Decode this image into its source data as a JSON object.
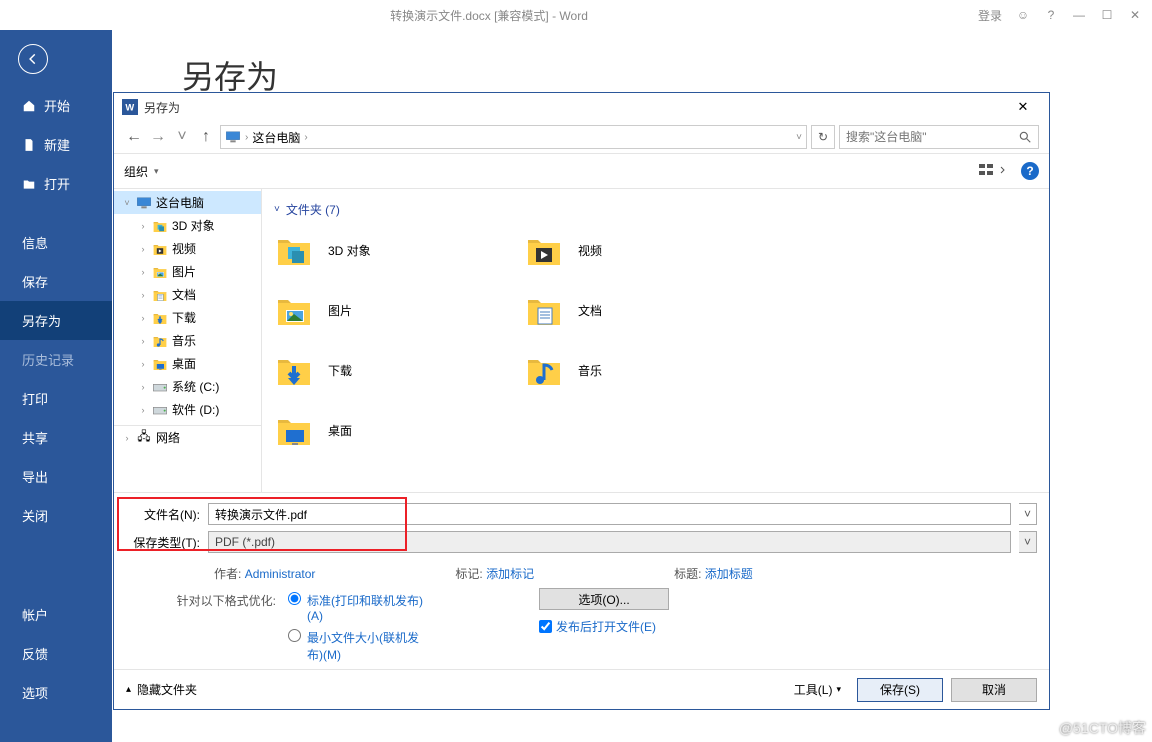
{
  "window": {
    "title": "转换演示文件.docx [兼容模式] - Word",
    "login": "登录"
  },
  "backstage": {
    "page_title": "另存为",
    "items": [
      {
        "label": "开始",
        "icon": "home"
      },
      {
        "label": "新建",
        "icon": "doc"
      },
      {
        "label": "打开",
        "icon": "open"
      },
      {
        "label": "信息"
      },
      {
        "label": "保存"
      },
      {
        "label": "另存为",
        "active": true
      },
      {
        "label": "历史记录",
        "dim": true
      },
      {
        "label": "打印"
      },
      {
        "label": "共享"
      },
      {
        "label": "导出"
      },
      {
        "label": "关闭"
      }
    ],
    "bottom": [
      {
        "label": "帐户"
      },
      {
        "label": "反馈"
      },
      {
        "label": "选项"
      }
    ]
  },
  "dialog": {
    "title": "另存为",
    "breadcrumb": "这台电脑",
    "breadcrumb_sep": "›",
    "search_placeholder": "搜索\"这台电脑\"",
    "toolbar": {
      "organize": "组织",
      "down": "▾"
    },
    "tree": {
      "root": "这台电脑",
      "items": [
        {
          "label": "3D 对象",
          "icon": "3d"
        },
        {
          "label": "视频",
          "icon": "video"
        },
        {
          "label": "图片",
          "icon": "pic"
        },
        {
          "label": "文档",
          "icon": "doc"
        },
        {
          "label": "下载",
          "icon": "download"
        },
        {
          "label": "音乐",
          "icon": "music"
        },
        {
          "label": "桌面",
          "icon": "desktop"
        },
        {
          "label": "系统 (C:)",
          "icon": "drive"
        },
        {
          "label": "软件 (D:)",
          "icon": "drive"
        }
      ],
      "network": "网络"
    },
    "pane": {
      "section": "文件夹 (7)",
      "items": [
        {
          "label": "3D 对象",
          "icon": "3d"
        },
        {
          "label": "视频",
          "icon": "video"
        },
        {
          "label": "图片",
          "icon": "pic"
        },
        {
          "label": "文档",
          "icon": "doc"
        },
        {
          "label": "下载",
          "icon": "download"
        },
        {
          "label": "音乐",
          "icon": "music"
        },
        {
          "label": "桌面",
          "icon": "desktop"
        }
      ]
    },
    "fields": {
      "filename_label": "文件名(N):",
      "filename_value": "转换演示文件.pdf",
      "type_label": "保存类型(T):",
      "type_value": "PDF (*.pdf)"
    },
    "meta": {
      "author_k": "作者:",
      "author_v": "Administrator",
      "tag_k": "标记:",
      "tag_v": "添加标记",
      "title_k": "标题:",
      "title_v": "添加标题"
    },
    "optimize": {
      "label": "针对以下格式优化:",
      "std": "标准(打印和联机发布)(A)",
      "min": "最小文件大小(联机发布)(M)",
      "options_btn": "选项(O)...",
      "open_after": "发布后打开文件(E)"
    },
    "footer": {
      "hide": "隐藏文件夹",
      "tools": "工具(L)",
      "save": "保存(S)",
      "cancel": "取消"
    }
  },
  "watermark": "@51CTO博客"
}
